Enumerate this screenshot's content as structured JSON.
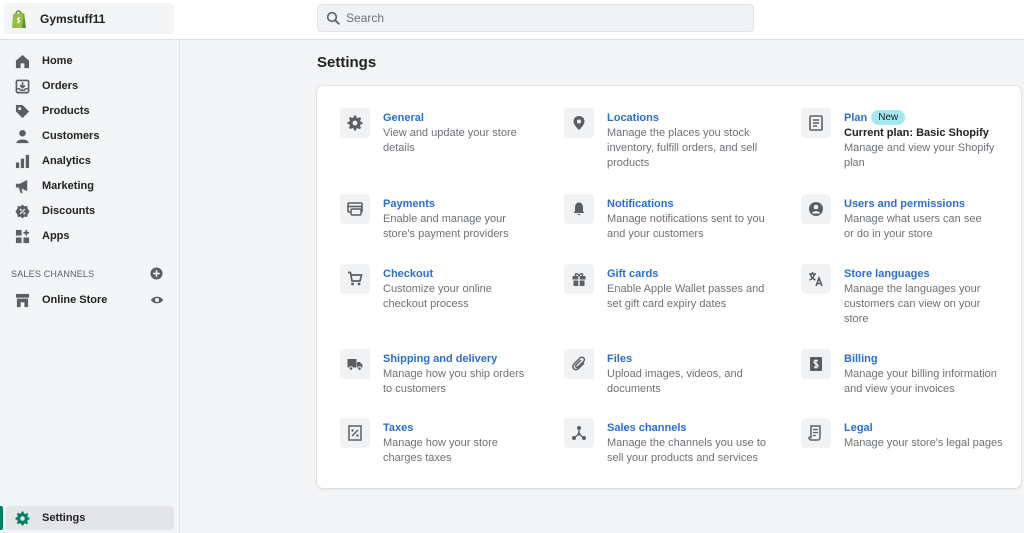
{
  "store": {
    "name": "Gymstuff11",
    "logo_icon": "shopify-bag-icon"
  },
  "search": {
    "placeholder": "Search"
  },
  "sidebar": {
    "items": [
      {
        "label": "Home",
        "icon": "home-icon"
      },
      {
        "label": "Orders",
        "icon": "orders-icon"
      },
      {
        "label": "Products",
        "icon": "tag-icon"
      },
      {
        "label": "Customers",
        "icon": "person-icon"
      },
      {
        "label": "Analytics",
        "icon": "bar-chart-icon"
      },
      {
        "label": "Marketing",
        "icon": "megaphone-icon"
      },
      {
        "label": "Discounts",
        "icon": "discount-icon"
      },
      {
        "label": "Apps",
        "icon": "apps-icon"
      }
    ],
    "sales_channels_label": "SALES CHANNELS",
    "online_store": {
      "label": "Online Store"
    },
    "settings": {
      "label": "Settings"
    }
  },
  "page": {
    "title": "Settings"
  },
  "settings": {
    "general": {
      "title": "General",
      "desc": "View and update your store details",
      "icon": "gear-icon"
    },
    "locations": {
      "title": "Locations",
      "desc": "Manage the places you stock inventory, fulfill orders, and sell products",
      "icon": "location-pin-icon"
    },
    "plan": {
      "title": "Plan",
      "badge": "New",
      "subtitle": "Current plan: Basic Shopify",
      "desc": "Manage and view your Shopify plan",
      "icon": "document-icon"
    },
    "payments": {
      "title": "Payments",
      "desc": "Enable and manage your store's payment providers",
      "icon": "payments-icon"
    },
    "notifications": {
      "title": "Notifications",
      "desc": "Manage notifications sent to you and your customers",
      "icon": "bell-icon"
    },
    "users": {
      "title": "Users and permissions",
      "desc": "Manage what users can see or do in your store",
      "icon": "user-circle-icon"
    },
    "checkout": {
      "title": "Checkout",
      "desc": "Customize your online checkout process",
      "icon": "cart-icon"
    },
    "gift_cards": {
      "title": "Gift cards",
      "desc": "Enable Apple Wallet passes and set gift card expiry dates",
      "icon": "gift-icon"
    },
    "store_languages": {
      "title": "Store languages",
      "desc": "Manage the languages your customers can view on your store",
      "icon": "translate-icon"
    },
    "shipping": {
      "title": "Shipping and delivery",
      "desc": "Manage how you ship orders to customers",
      "icon": "truck-icon"
    },
    "files": {
      "title": "Files",
      "desc": "Upload images, videos, and documents",
      "icon": "paperclip-icon"
    },
    "billing": {
      "title": "Billing",
      "desc": "Manage your billing information and view your invoices",
      "icon": "billing-icon"
    },
    "taxes": {
      "title": "Taxes",
      "desc": "Manage how your store charges taxes",
      "icon": "taxes-icon"
    },
    "sales_channels": {
      "title": "Sales channels",
      "desc": "Manage the channels you use to sell your products and services",
      "icon": "channels-icon"
    },
    "legal": {
      "title": "Legal",
      "desc": "Manage your store's legal pages",
      "icon": "legal-icon"
    }
  },
  "colors": {
    "accent": "#008060",
    "link": "#2c6ecb",
    "badge": "#a4e8f2",
    "icon": "#5c5f62"
  }
}
